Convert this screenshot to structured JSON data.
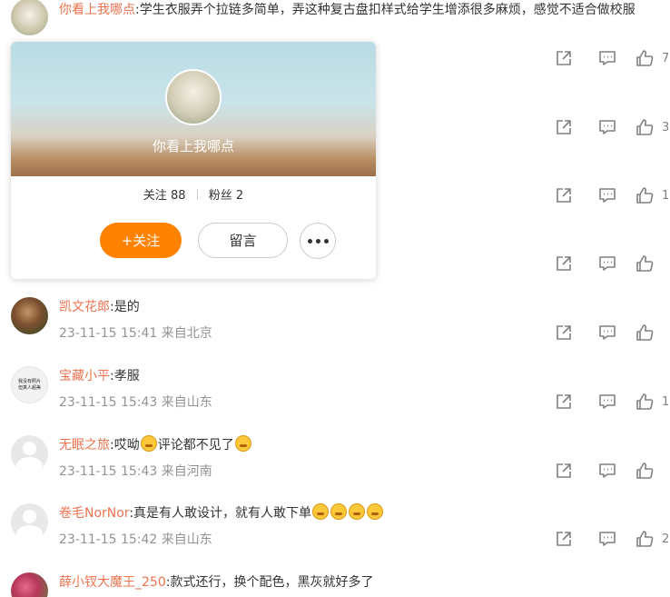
{
  "comments": [
    {
      "user": "你看上我哪点",
      "text": ":学生衣服弄个拉链多简单，弄这种复古盘扣样式给学生增添很多麻烦，感觉不适合做校服",
      "likes": "7"
    },
    {
      "likes": "3"
    },
    {
      "likes": "1"
    },
    {
      "likes": ""
    },
    {
      "user": "凯文花郎",
      "text": ":是的",
      "time": "23-11-15 15:41",
      "loc": "来自北京",
      "likes": ""
    },
    {
      "user": "宝藏小平",
      "text": ":孝服",
      "time": "23-11-15 15:43",
      "loc": "来自山东",
      "likes": "1"
    },
    {
      "user": "无眠之旅",
      "text_a": ":哎呦",
      "text_b": "评论都不见了",
      "time": "23-11-15 15:43",
      "loc": "来自河南",
      "likes": ""
    },
    {
      "user": "卷毛NorNor",
      "text": ":真是有人敢设计，就有人敢下单",
      "time": "23-11-15 15:42",
      "loc": "来自山东",
      "likes": "2"
    },
    {
      "user": "薛小钗大魔王_250",
      "text": ":款式还行，换个配色，黑灰就好多了"
    }
  ],
  "avatar_text": "我没有照片但真人超美",
  "card": {
    "name": "你看上我哪点",
    "following_label": "关注",
    "following": "88",
    "followers_label": "粉丝",
    "followers": "2",
    "follow_button": "+关注",
    "message_button": "留言"
  },
  "icons": {
    "share": "share-icon",
    "comment": "comment-icon",
    "like": "thumbs-up-icon",
    "more": "more-icon"
  },
  "colors": {
    "username": "#eb7350",
    "follow": "#ff8200",
    "meta": "#939393"
  }
}
